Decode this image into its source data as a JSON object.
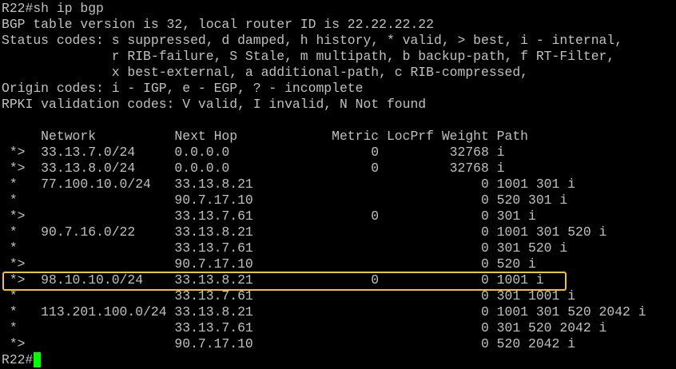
{
  "terminal": {
    "header_lines": [
      "R22#sh ip bgp",
      "BGP table version is 32, local router ID is 22.22.22.22",
      "Status codes: s suppressed, d damped, h history, * valid, > best, i - internal,",
      "              r RIB-failure, S Stale, m multipath, b backup-path, f RT-Filter,",
      "              x best-external, a additional-path, c RIB-compressed,",
      "Origin codes: i - IGP, e - EGP, ? - incomplete",
      "RPKI validation codes: V valid, I invalid, N Not found",
      ""
    ],
    "table_header": "     Network          Next Hop            Metric LocPrf Weight Path",
    "rows": [
      " *>  33.13.7.0/24     0.0.0.0                  0         32768 i",
      " *>  33.13.8.0/24     0.0.0.0                  0         32768 i",
      " *   77.100.10.0/24   33.13.8.21                             0 1001 301 i",
      " *                    90.7.17.10                             0 520 301 i",
      " *>                   33.13.7.61               0             0 301 i",
      " *   90.7.16.0/22     33.13.8.21                             0 1001 301 520 i",
      " *                    33.13.7.61                             0 301 520 i",
      " *>                   90.7.17.10                             0 520 i",
      " *>  98.10.10.0/24    33.13.8.21               0             0 1001 i",
      " *                    33.13.7.61                             0 301 1001 i",
      " *   113.201.100.0/24 33.13.8.21                             0 1001 301 520 2042 i",
      " *                    33.13.7.61                             0 301 520 2042 i",
      " *>                   90.7.17.10                             0 520 2042 i"
    ],
    "prompt": "R22#"
  },
  "colors": {
    "background": "#000000",
    "text": "#c0c0c0",
    "cursor": "#00ff00",
    "highlight_border": "#f2c13a"
  }
}
